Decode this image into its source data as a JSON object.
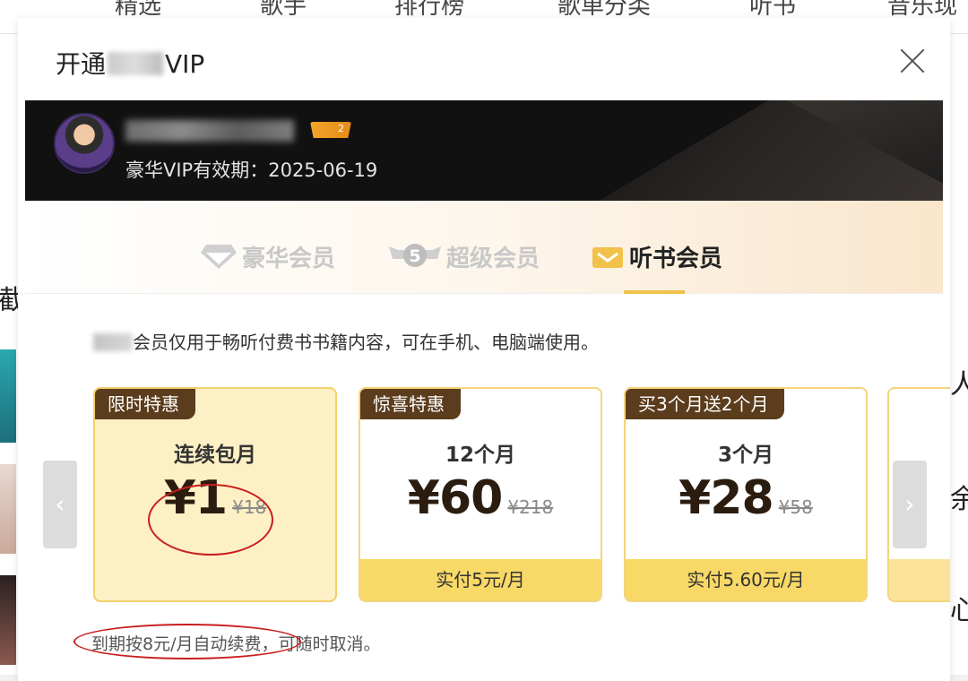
{
  "background_nav": {
    "items": [
      "精选",
      "歌手",
      "排行榜",
      "歌单分类",
      "听书",
      "音乐现场"
    ]
  },
  "background_side": {
    "right_chars": [
      "人",
      "余",
      "心"
    ],
    "left_chars": [
      "截"
    ]
  },
  "modal": {
    "title_prefix": "开通",
    "title_suffix": "VIP",
    "close_label": "×"
  },
  "user": {
    "vip_level": "2",
    "expiry_text": "豪华VIP有效期：2025-06-19"
  },
  "tabs": [
    {
      "label": "豪华会员",
      "icon": "diamond-icon",
      "active": false
    },
    {
      "label": "超级会员",
      "icon": "super-s-badge-icon",
      "active": false
    },
    {
      "label": "听书会员",
      "icon": "audiobook-icon",
      "active": true
    }
  ],
  "description_text": "会员仅用于畅听付费书书籍内容，可在手机、电脑端使用。",
  "cards": [
    {
      "tag": "限时特惠",
      "period": "连续包月",
      "price": "¥1",
      "original": "¥18",
      "footer": "",
      "selected": true
    },
    {
      "tag": "惊喜特惠",
      "period": "12个月",
      "price": "¥60",
      "original": "¥218",
      "footer": "实付5元/月",
      "selected": false
    },
    {
      "tag": "买3个月送2个月",
      "period": "3个月",
      "price": "¥28",
      "original": "¥58",
      "footer": "实付5.60元/月",
      "selected": false
    }
  ],
  "arrows": {
    "prev": "‹",
    "next": "›"
  },
  "footnote": {
    "highlight": "到期按8元/月自动续费",
    "rest": "，可随时取消。"
  },
  "colors": {
    "accent_gold": "#f2c14a",
    "tag_brown": "#5b3c1c",
    "annotation_red": "#c81e1e",
    "card_border": "#f4d57c"
  }
}
